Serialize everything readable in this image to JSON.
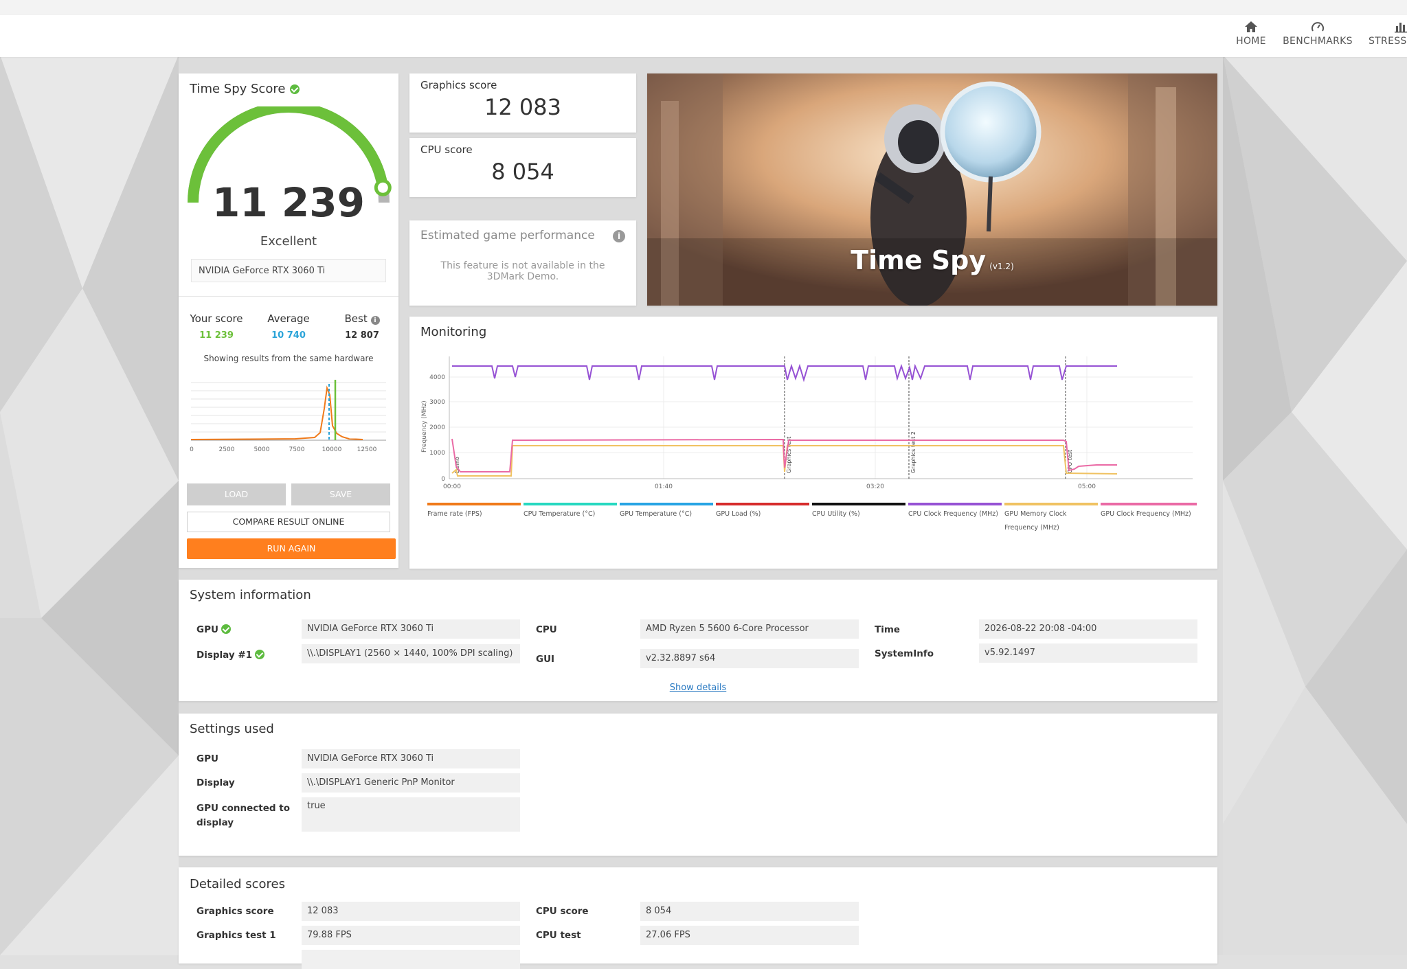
{
  "nav": {
    "home": "HOME",
    "benchmarks": "BENCHMARKS",
    "stress": "STRESS T"
  },
  "score_card": {
    "title": "Time Spy Score",
    "score": "11 239",
    "rating": "Excellent",
    "gpu": "NVIDIA GeForce RTX 3060 Ti",
    "gauge_fill": 0.95,
    "your_label": "Your score",
    "your_value": "11 239",
    "avg_label": "Average",
    "avg_value": "10 740",
    "best_label": "Best",
    "best_value": "12 807",
    "same_hw": "Showing results from the same hardware",
    "dist_ticks": [
      "0",
      "2500",
      "5000",
      "7500",
      "10000",
      "12500"
    ],
    "load": "LOAD",
    "save": "SAVE",
    "compare": "COMPARE RESULT ONLINE",
    "run_again": "RUN AGAIN"
  },
  "graphics": {
    "label": "Graphics score",
    "value": "12 083"
  },
  "cpu": {
    "label": "CPU score",
    "value": "8 054"
  },
  "estimate": {
    "title": "Estimated game performance",
    "text": "This feature is not available in the 3DMark Demo."
  },
  "banner": {
    "title": "Time Spy",
    "version": "(v1.2)"
  },
  "monitoring": {
    "title": "Monitoring",
    "ylabel": "Frequency (MHz)",
    "yticks": [
      "4000",
      "3000",
      "2000",
      "1000",
      "0"
    ],
    "xticks": [
      "00:00",
      "01:40",
      "03:20",
      "05:00"
    ],
    "phases": [
      "Demo",
      "Graphics test",
      "Graphics test 2",
      "CPU test"
    ],
    "legend": [
      {
        "label": "Frame rate (FPS)",
        "color": "#f07a1a"
      },
      {
        "label": "CPU Temperature (°C)",
        "color": "#26d8c0"
      },
      {
        "label": "GPU Temperature (°C)",
        "color": "#27a4e4"
      },
      {
        "label": "GPU Load (%)",
        "color": "#d62b2b"
      },
      {
        "label": "CPU Utility (%)",
        "color": "#111111"
      },
      {
        "label": "CPU Clock Frequency (MHz)",
        "color": "#9652d4"
      },
      {
        "label": "GPU Memory Clock Frequency (MHz)",
        "color": "#f0c262"
      },
      {
        "label": "GPU Clock Frequency (MHz)",
        "color": "#ea6aa5"
      }
    ]
  },
  "sysinfo": {
    "title": "System information",
    "gpu_label": "GPU",
    "gpu_value": "NVIDIA GeForce RTX 3060 Ti",
    "display_label": "Display #1",
    "display_value": "\\\\.\\DISPLAY1 (2560 × 1440, 100% DPI scaling)",
    "cpu_label": "CPU",
    "cpu_value": "AMD Ryzen 5 5600 6-Core Processor",
    "gui_label": "GUI",
    "gui_value": "v2.32.8897 s64",
    "time_label": "Time",
    "time_value": "2026-08-22 20:08 -04:00",
    "sysinfo_label": "SystemInfo",
    "sysinfo_value": "v5.92.1497",
    "show_details": "Show details"
  },
  "settings": {
    "title": "Settings used",
    "gpu_label": "GPU",
    "gpu_value": "NVIDIA GeForce RTX 3060 Ti",
    "display_label": "Display",
    "display_value": "\\\\.\\DISPLAY1 Generic PnP Monitor",
    "connected_label": "GPU connected to display",
    "connected_value": "true"
  },
  "detailed": {
    "title": "Detailed scores",
    "graphics_label": "Graphics score",
    "graphics_value": "12 083",
    "gt1_label": "Graphics test 1",
    "gt1_value": "79.88 FPS",
    "cpu_label": "CPU score",
    "cpu_value": "8 054",
    "cputest_label": "CPU test",
    "cputest_value": "27.06 FPS"
  },
  "colors": {
    "accent_orange": "#ff7f1e",
    "green": "#6cc03a",
    "avg_blue": "#2aa3d8",
    "purple": "#9652d4",
    "pink": "#ea6aa5",
    "gold": "#f0c262"
  }
}
